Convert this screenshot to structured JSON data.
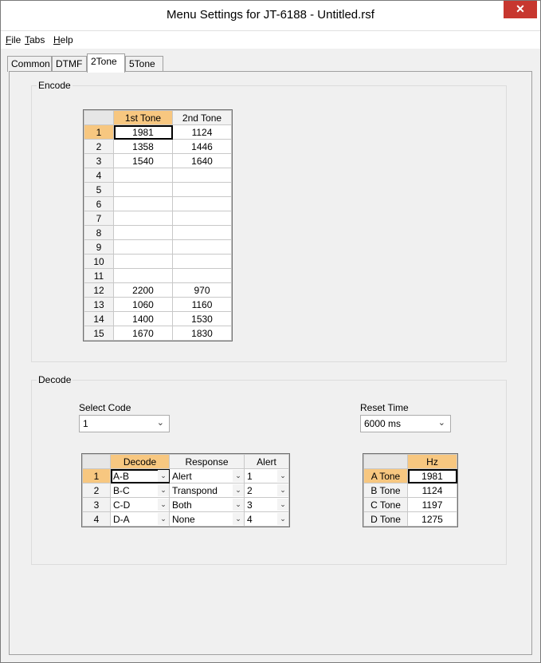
{
  "window": {
    "title": "Menu Settings for JT-6188 - Untitled.rsf",
    "close_glyph": "✕"
  },
  "menu": [
    {
      "accel": "F",
      "rest": "ile"
    },
    {
      "accel": "T",
      "rest": "abs"
    },
    {
      "accel": "H",
      "rest": "elp"
    }
  ],
  "tabs": [
    "Common",
    "DTMF",
    "2Tone",
    "5Tone"
  ],
  "active_tab": "2Tone",
  "encode": {
    "label": "Encode",
    "headers": [
      "1st Tone",
      "2nd Tone"
    ],
    "rows": [
      [
        "1",
        "1981",
        "1124"
      ],
      [
        "2",
        "1358",
        "1446"
      ],
      [
        "3",
        "1540",
        "1640"
      ],
      [
        "4",
        "",
        ""
      ],
      [
        "5",
        "",
        ""
      ],
      [
        "6",
        "",
        ""
      ],
      [
        "7",
        "",
        ""
      ],
      [
        "8",
        "",
        ""
      ],
      [
        "9",
        "",
        ""
      ],
      [
        "10",
        "",
        ""
      ],
      [
        "11",
        "",
        ""
      ],
      [
        "12",
        "2200",
        "970"
      ],
      [
        "13",
        "1060",
        "1160"
      ],
      [
        "14",
        "1400",
        "1530"
      ],
      [
        "15",
        "1670",
        "1830"
      ]
    ]
  },
  "decode": {
    "label": "Decode",
    "select_code_label": "Select Code",
    "select_code_value": "1",
    "reset_time_label": "Reset Time",
    "reset_time_value": "6000 ms",
    "headers": [
      "Decode",
      "Response",
      "Alert"
    ],
    "rows": [
      [
        "1",
        "A-B",
        "Alert",
        "1"
      ],
      [
        "2",
        "B-C",
        "Transpond",
        "2"
      ],
      [
        "3",
        "C-D",
        "Both",
        "3"
      ],
      [
        "4",
        "D-A",
        "None",
        "4"
      ]
    ],
    "hz_header": "Hz",
    "hz_rows": [
      [
        "A Tone",
        "1981"
      ],
      [
        "B Tone",
        "1124"
      ],
      [
        "C Tone",
        "1197"
      ],
      [
        "D Tone",
        "1275"
      ]
    ]
  },
  "icons": {
    "dropdown": "chevron-down-icon",
    "close": "close-icon"
  }
}
